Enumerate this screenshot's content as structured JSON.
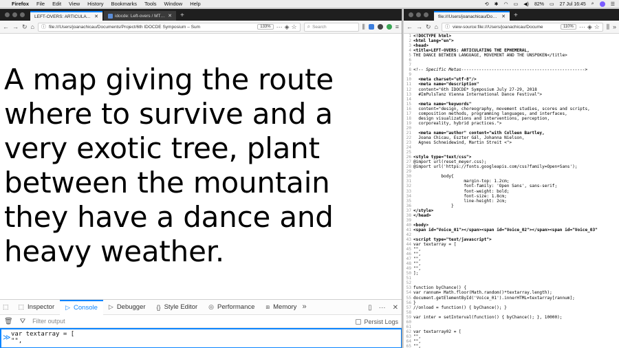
{
  "menubar": {
    "app": "Firefox",
    "items": [
      "File",
      "Edit",
      "View",
      "History",
      "Bookmarks",
      "Tools",
      "Window",
      "Help"
    ],
    "battery": "82%",
    "clock": "27 Jul 16:45"
  },
  "left": {
    "tabs": [
      {
        "label": "LEFT-OVERS: ARTICULATING THE E",
        "active": true
      },
      {
        "label": "idocde: Left-overs / MTD Resid",
        "active": false
      }
    ],
    "url": "file:///Users/joanachicau/Documents/Project/6th IDOCDE Symposium – Sum",
    "zoom": "133%",
    "search_placeholder": "Search",
    "page_text": "A map giving the route where to survive and a very exotic tree, plant between the mountain they have a dance and heavy weather.",
    "devtools": {
      "tabs": [
        "Inspector",
        "Console",
        "Debugger",
        "Style Editor",
        "Performance",
        "Memory"
      ],
      "active_tab": "Console",
      "filter_placeholder": "Filter output",
      "persist_label": "Persist Logs",
      "input_lines": [
        "var textarray = [",
        "\"\",",
        "..."
      ]
    }
  },
  "right": {
    "tab_label": "file:///Users/joanachicau/Docume",
    "url": "view-source:file:///Users/joanachicau/Docume",
    "zoom": "110%",
    "source_lines": [
      "<!DOCTYPE html>",
      "<html lang=\"en\">",
      "<head>",
      "<title>LEFT-OVERS: ARTICULATING THE EPHEMERAL,",
      "THE DANCE BETWEEN LANGUAGE, MOVEMENT AND THE UNSPOKEN</title>",
      "",
      "",
      "<!-- Specific Metas------------------------------------------------->",
      "",
      "  <meta charset=\"utf-8\"/>",
      "  <meta name=\"description\"",
      "  content=\"6th IDOCDE* Symposium July 27-29, 2018",
      "  #ImPulsTanz Vienna International Dance Festival\">",
      "",
      "  <meta name=\"keywords\"",
      "  content=\"design, choreography, movement studies, scores and scripts,",
      "  composition methods, programming languages, and interfaces,",
      "  design visualizations and interventions, perception,",
      "  corporeality, hybrid practices.\">",
      "",
      "  <meta name=\"author\" content=\"with Colleen Bartley,",
      "  Joana Chicau, Eszter Gál, Johanna Nielson,",
      "  Agnes Schneidewind, Martin Streit <\">",
      "",
      "",
      "<style type=\"text/css\">",
      "@import url(reset_meyer.css);",
      "@import url('https://fonts.googleapis.com/css?family=Open+Sans');",
      "",
      "           body{",
      "                    margin-top: 1.2cm;",
      "                    font-family: 'Open Sans', sans-serif;",
      "                    font-weight: bold;",
      "                    font-size: 1.8cm;",
      "                    line-height: 2cm;",
      "               }",
      "</style>",
      "</head>",
      "",
      "<body>",
      "<span id=\"Voice_01\"></span><span id=\"Voice_02\"></span><span id=\"Voice_03\"",
      "",
      "<script type=\"text/javascript\">",
      "var textarray = [",
      "\"\",",
      "\"\",",
      "\"\",",
      "\"\",",
      "\"\",",
      "];",
      "",
      "",
      "function byChance() {",
      "var rannum= Math.floor(Math.random()*textarray.length);",
      "document.getElementById('Voice_01').innerHTML=textarray[rannum];",
      "}",
      "//onload = function() { byChance(); }",
      "",
      "var inter = setInterval(function() { byChance(); }, 10000);",
      "",
      "",
      "var textarray02 = [",
      "\"\",",
      "\"\",",
      "\"\","
    ]
  }
}
